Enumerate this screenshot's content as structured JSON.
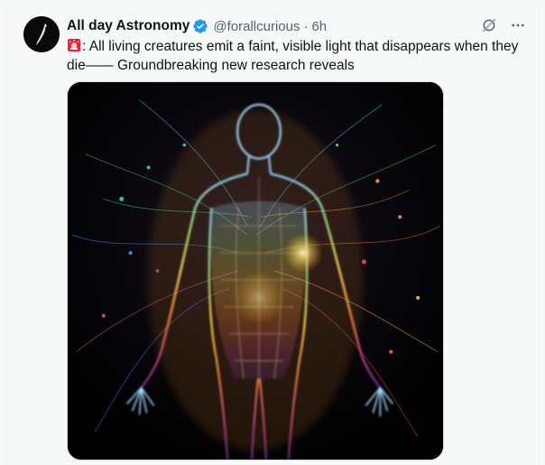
{
  "tweet": {
    "author": {
      "display_name": "All day Astronomy",
      "handle": "@forallcurious",
      "verified": true,
      "avatar_icon": "avatar-logo-icon"
    },
    "separator": "·",
    "timestamp": "6h",
    "text_emoji_icon": "rotating-light-icon",
    "text": ": All living creatures emit a faint, visible light that disappears when they die—— Groundbreaking new research reveals",
    "actions": [
      {
        "name": "grok-icon"
      },
      {
        "name": "more-icon"
      }
    ],
    "media": {
      "type": "image",
      "icon": "glowing-human-figure-image"
    }
  },
  "colors": {
    "verified_badge": "#1d9bf0",
    "secondary_text": "#536471",
    "primary_text": "#0f1419",
    "alarm_red": "#f4212e"
  }
}
